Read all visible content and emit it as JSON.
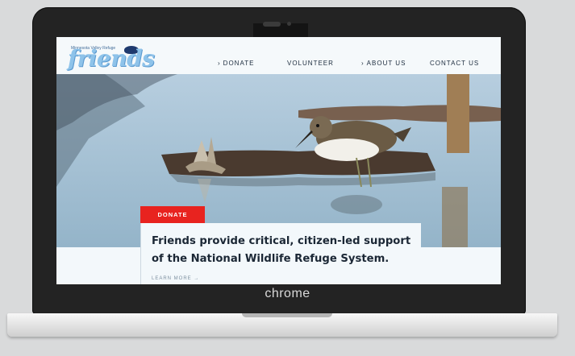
{
  "device": {
    "brand_label": "chrome"
  },
  "site": {
    "logo": {
      "small_text": "Minnesota Valley Refuge",
      "word": "friends"
    },
    "nav": {
      "donate": "DONATE",
      "volunteer": "VOLUNTEER",
      "about": "ABOUT US",
      "contact": "CONTACT US"
    },
    "hero": {
      "donate_tag": "DONATE",
      "headline": "Friends provide critical, citizen-led support of the National Wildlife Refuge System.",
      "learn_more": "LEARN MORE →"
    }
  },
  "colors": {
    "accent": "#e8231f",
    "logo": "#8ec3ea",
    "nav_text": "#1c2c3e",
    "bezel": "#232323"
  }
}
